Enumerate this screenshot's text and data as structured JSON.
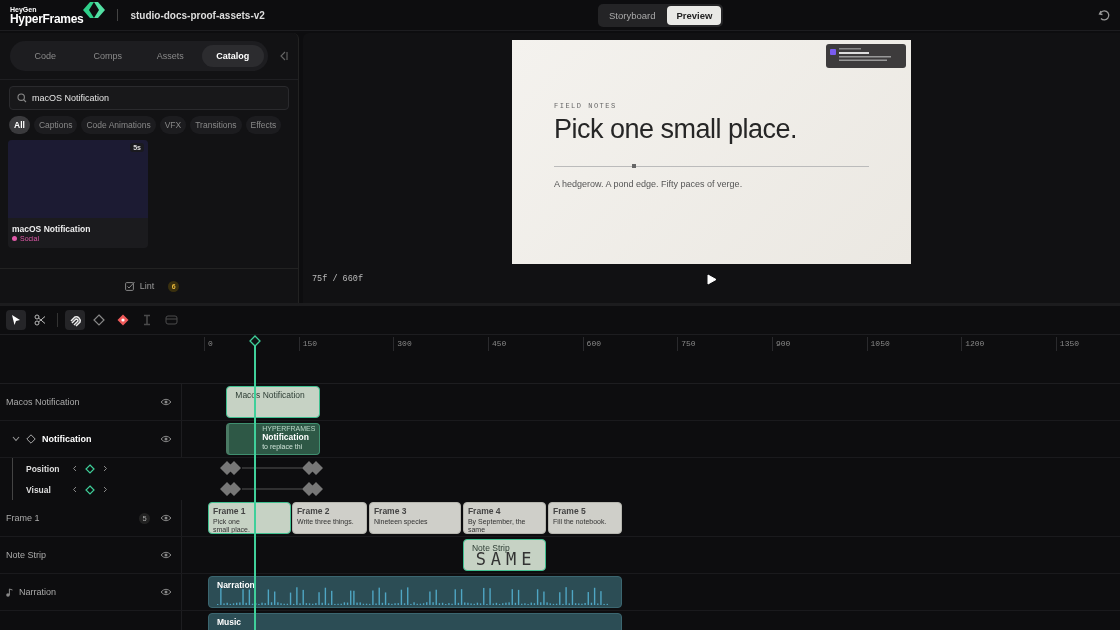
{
  "header": {
    "brand_top": "HeyGen",
    "brand": "HyperFrames",
    "project": "studio-docs-proof-assets-v2"
  },
  "view_modes": [
    {
      "label": "Storyboard",
      "selected": false
    },
    {
      "label": "Preview",
      "selected": true
    }
  ],
  "sidebar": {
    "tabs": [
      {
        "label": "Code",
        "selected": false
      },
      {
        "label": "Comps",
        "selected": false
      },
      {
        "label": "Assets",
        "selected": false
      },
      {
        "label": "Catalog",
        "selected": true
      }
    ],
    "search": {
      "value": "macOS Notification"
    },
    "filters": [
      {
        "label": "All",
        "selected": true
      },
      {
        "label": "Captions",
        "selected": false
      },
      {
        "label": "Code Animations",
        "selected": false
      },
      {
        "label": "VFX",
        "selected": false
      },
      {
        "label": "Transitions",
        "selected": false
      },
      {
        "label": "Effects",
        "selected": false
      }
    ],
    "cards": [
      {
        "title": "macOS Notification",
        "duration": "5s",
        "tag": "Social",
        "color": "#e05aa8"
      }
    ],
    "lint": {
      "label": "Lint",
      "count": "6"
    }
  },
  "preview": {
    "slide": {
      "eyebrow": "FIELD NOTES",
      "headline": "Pick one small place.",
      "body": "A hedgerow. A pond edge. Fifty paces of verge."
    },
    "frame_counter": "75f / 660f"
  },
  "timeline": {
    "tools": [
      {
        "kind": "select",
        "active": true,
        "disabled": false
      },
      {
        "kind": "cut",
        "active": false,
        "disabled": false
      },
      {
        "kind": "snap",
        "active": true,
        "disabled": false
      },
      {
        "kind": "keyframe",
        "active": false,
        "disabled": false
      },
      {
        "kind": "add-keyframe",
        "active": false,
        "disabled": false
      },
      {
        "kind": "text",
        "active": false,
        "disabled": true
      },
      {
        "kind": "film",
        "active": false,
        "disabled": true
      }
    ],
    "ruler": [
      "0",
      "150",
      "300",
      "450",
      "600",
      "750",
      "900",
      "1050",
      "1200",
      "1350"
    ],
    "playhead": {
      "level": 0.078
    },
    "tracks": [
      {
        "kind": "clip",
        "name": "Macos Notification",
        "clips": [
          {
            "label": "Macos Notification"
          }
        ]
      },
      {
        "kind": "group",
        "name": "Notification",
        "expanded": true,
        "clips": [
          {
            "label": "Notification",
            "lines": [
              "HYPERFRAMES",
              "to replace thi"
            ]
          }
        ],
        "properties": [
          {
            "name": "Position"
          },
          {
            "name": "Visual"
          }
        ]
      },
      {
        "kind": "frames",
        "name": "Frame 1",
        "count": "5",
        "clips": [
          {
            "label": "Frame 1",
            "caption": "Pick one small place.",
            "selected": true
          },
          {
            "label": "Frame 2",
            "caption": "Write three things.",
            "selected": false
          },
          {
            "label": "Frame 3",
            "caption": "Nineteen species",
            "selected": false
          },
          {
            "label": "Frame 4",
            "caption": "By September, the same",
            "selected": false
          },
          {
            "label": "Frame 5",
            "caption": "Fill the notebook.",
            "selected": false
          }
        ]
      },
      {
        "kind": "clip",
        "name": "Note Strip",
        "clips": [
          {
            "label": "Note Strip",
            "big": "SAME"
          }
        ]
      },
      {
        "kind": "audio",
        "name": "Narration",
        "clips": [
          {
            "label": "Narration"
          }
        ]
      },
      {
        "kind": "audio",
        "clips": [
          {
            "label": "Music"
          }
        ]
      }
    ]
  }
}
